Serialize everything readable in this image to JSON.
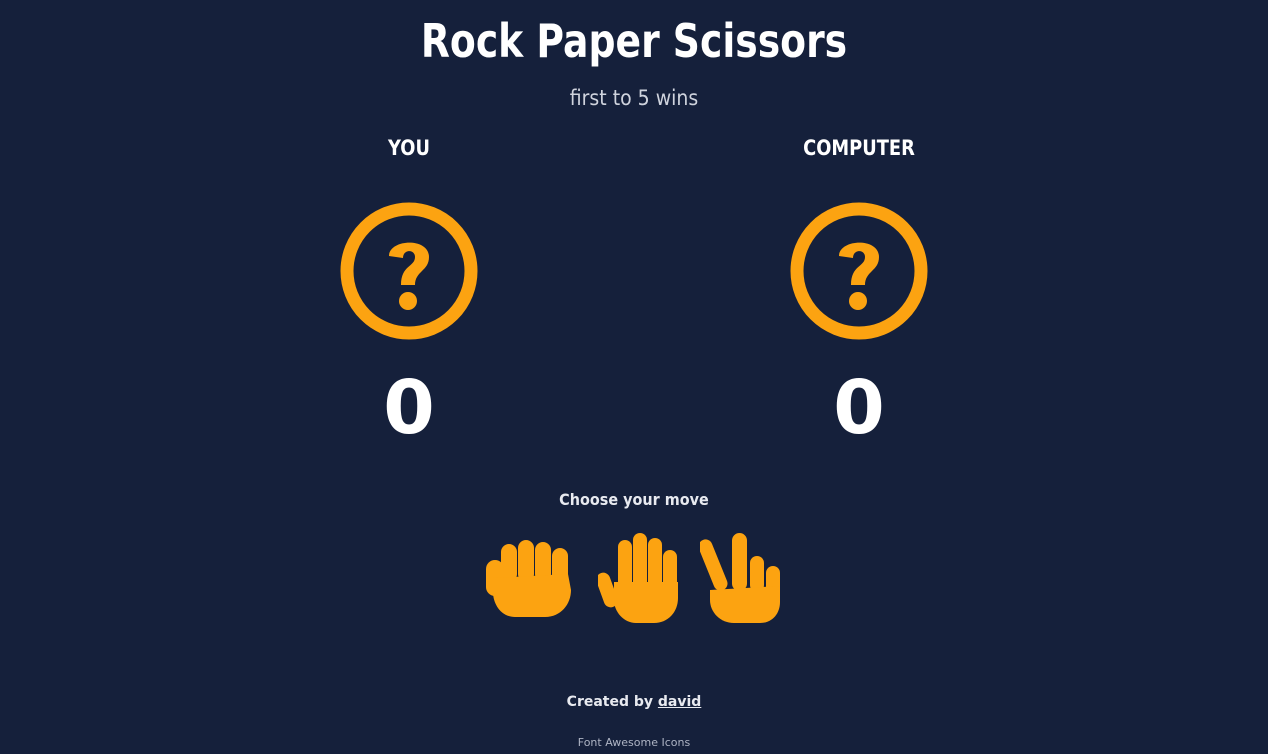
{
  "header": {
    "title": "Rock Paper Scissors",
    "subtitle": "first to 5 wins"
  },
  "players": {
    "you": {
      "label": "YOU",
      "choice_icon": "question-circle-icon",
      "score": "0"
    },
    "computer": {
      "label": "COMPUTER",
      "choice_icon": "question-circle-icon",
      "score": "0"
    }
  },
  "moves": {
    "prompt": "Choose your move",
    "options": [
      {
        "name": "rock",
        "icon": "hand-rock-icon"
      },
      {
        "name": "paper",
        "icon": "hand-paper-icon"
      },
      {
        "name": "scissors",
        "icon": "hand-scissors-icon"
      }
    ]
  },
  "footer": {
    "created_by": "Created by",
    "author_link": "david",
    "credits": "Font Awesome Icons"
  },
  "colors": {
    "background": "#15203b",
    "accent": "#fca311",
    "text": "#ffffff"
  }
}
